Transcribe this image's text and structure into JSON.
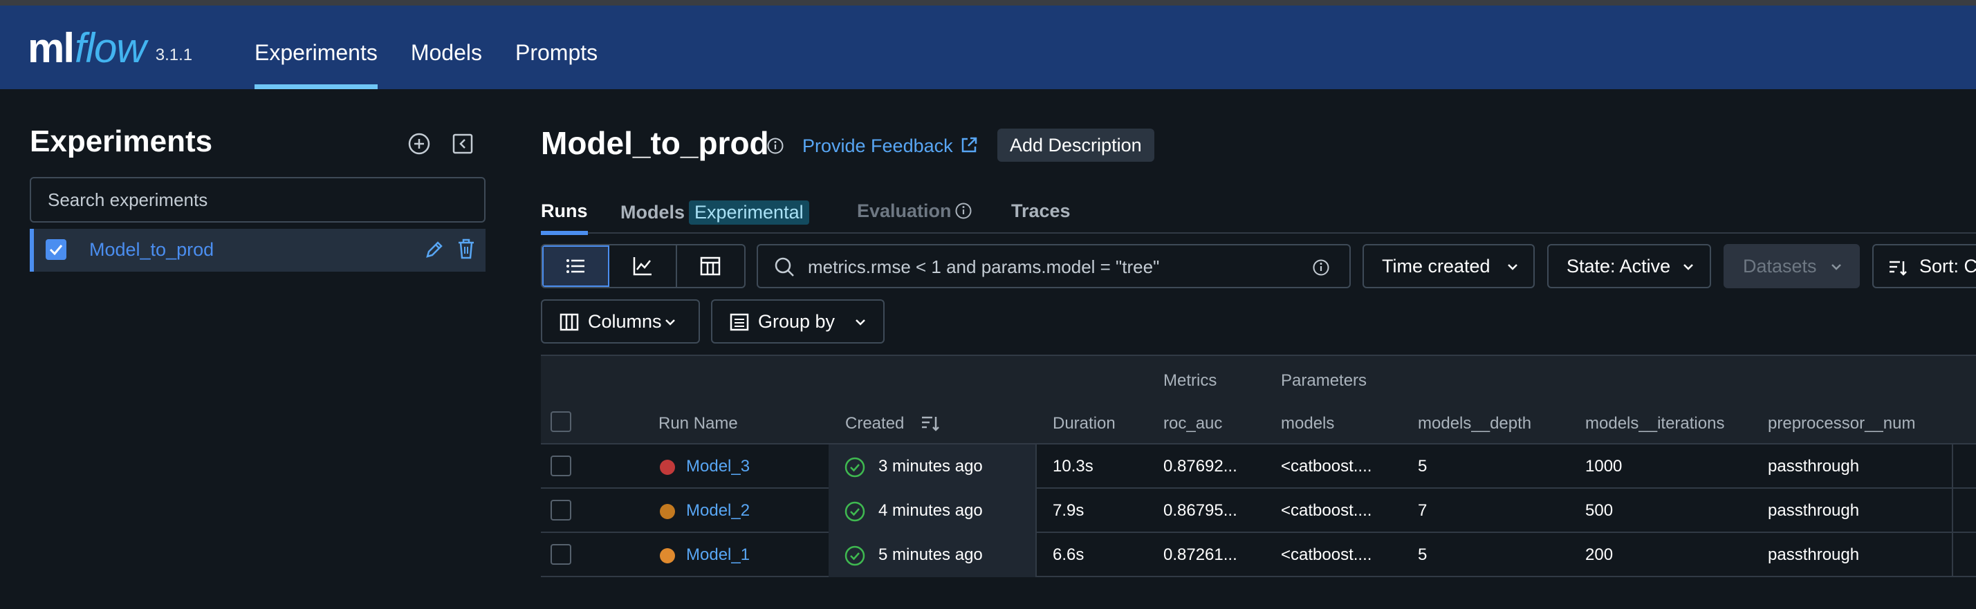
{
  "app": {
    "logo_ml": "ml",
    "logo_flow": "flow",
    "version": "3.1.1",
    "nav": [
      "Experiments",
      "Models",
      "Prompts"
    ],
    "active_nav": "Experiments"
  },
  "sidebar": {
    "title": "Experiments",
    "search_placeholder": "Search experiments",
    "items": [
      {
        "label": "Model_to_prod",
        "checked": true
      }
    ]
  },
  "experiment": {
    "title": "Model_to_prod",
    "feedback_label": "Provide Feedback",
    "add_description_label": "Add Description"
  },
  "tabs": [
    {
      "label": "Runs",
      "active": true
    },
    {
      "label": "Models",
      "badge": "Experimental"
    },
    {
      "label": "Evaluation",
      "disabled": true
    },
    {
      "label": "Traces"
    }
  ],
  "toolbar": {
    "search_value": "metrics.rmse < 1 and params.model = \"tree\"",
    "time_created": "Time created",
    "state": "State: Active",
    "datasets": "Datasets",
    "sort": "Sort: C",
    "columns": "Columns",
    "group_by": "Group by"
  },
  "table": {
    "groups": {
      "metrics": "Metrics",
      "parameters": "Parameters"
    },
    "headers": {
      "run_name": "Run Name",
      "created": "Created",
      "duration": "Duration",
      "roc_auc": "roc_auc",
      "models": "models",
      "models_depth": "models__depth",
      "models_iterations": "models__iterations",
      "preprocessor_num": "preprocessor__num"
    },
    "rows": [
      {
        "run_name": "Model_3",
        "color": "#c23a3a",
        "created": "3 minutes ago",
        "duration": "10.3s",
        "roc_auc": "0.87692...",
        "models": "<catboost....",
        "depth": "5",
        "iterations": "1000",
        "preprocessor": "passthrough"
      },
      {
        "run_name": "Model_2",
        "color": "#c47a20",
        "created": "4 minutes ago",
        "duration": "7.9s",
        "roc_auc": "0.86795...",
        "models": "<catboost....",
        "depth": "7",
        "iterations": "500",
        "preprocessor": "passthrough"
      },
      {
        "run_name": "Model_1",
        "color": "#e08a2e",
        "created": "5 minutes ago",
        "duration": "6.6s",
        "roc_auc": "0.87261...",
        "models": "<catboost....",
        "depth": "5",
        "iterations": "200",
        "preprocessor": "passthrough"
      }
    ]
  },
  "colors": {
    "header_bg": "#1b3a74",
    "accent": "#4b8ef0",
    "link": "#58a6f4",
    "success": "#3fb950"
  }
}
